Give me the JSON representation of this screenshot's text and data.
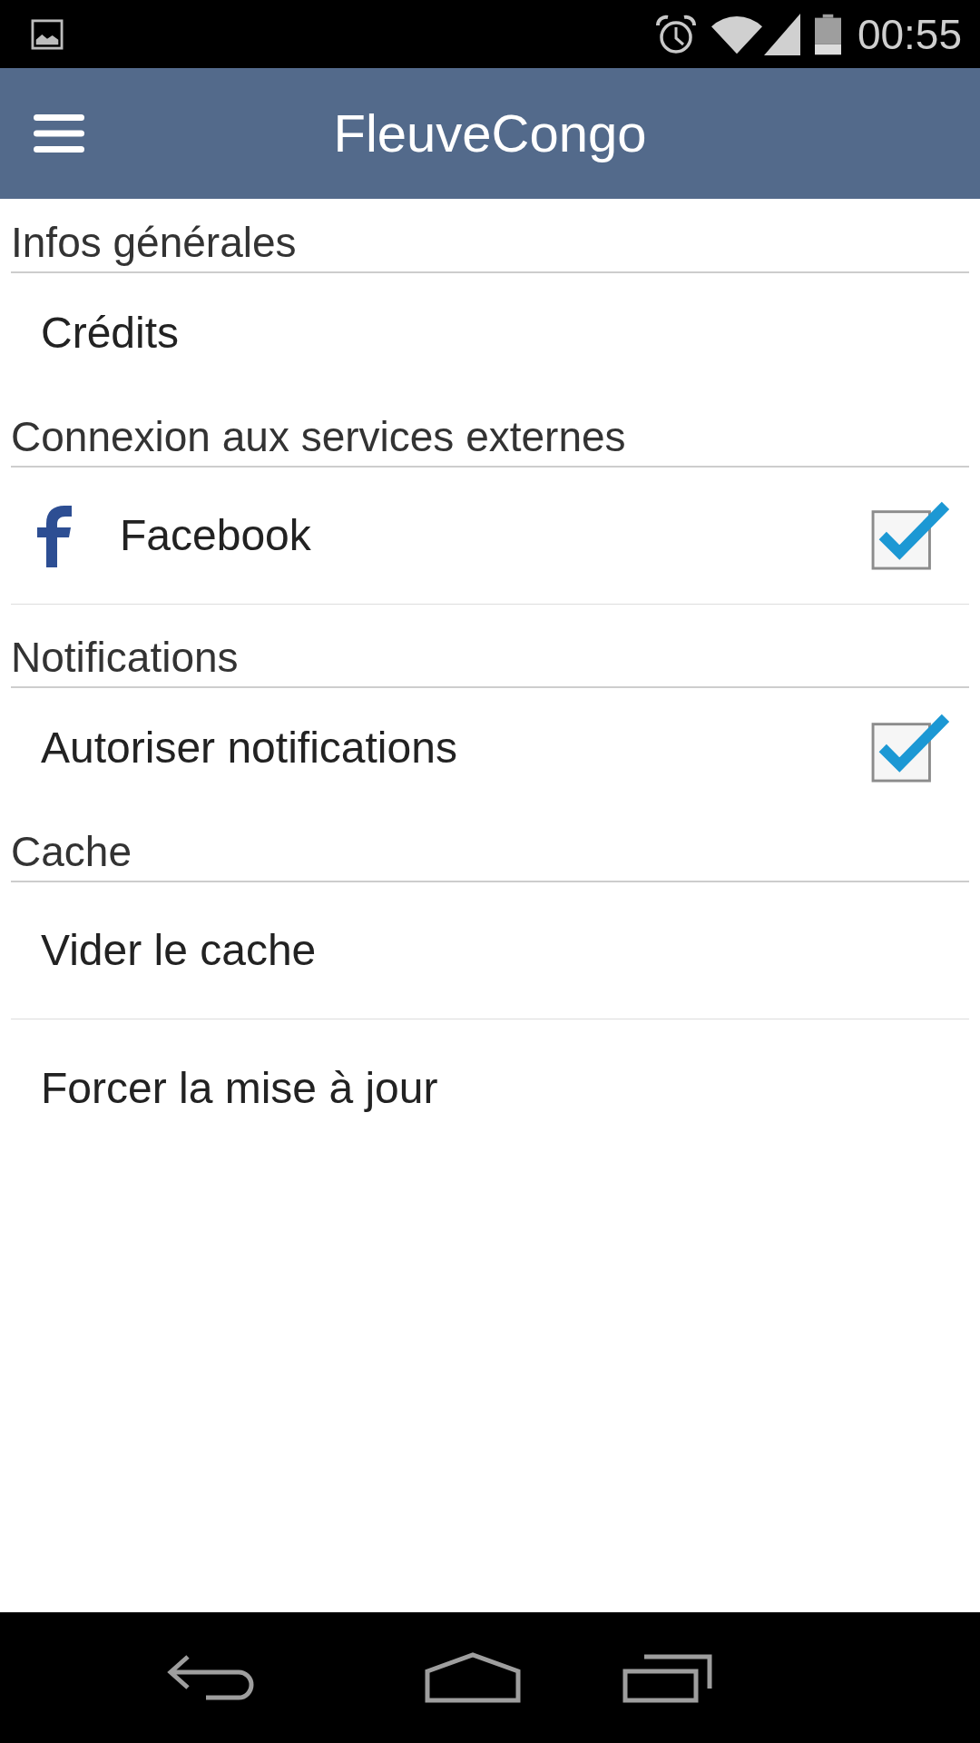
{
  "status_bar": {
    "time": "00:55"
  },
  "app_bar": {
    "title": "FleuveCongo"
  },
  "sections": [
    {
      "title": "Infos générales",
      "items": [
        {
          "kind": "link",
          "label": "Crédits",
          "divider": false
        }
      ]
    },
    {
      "title": "Connexion aux services externes",
      "items": [
        {
          "kind": "account",
          "label": "Facebook",
          "checked": true,
          "divider": true
        }
      ]
    },
    {
      "title": "Notifications",
      "items": [
        {
          "kind": "toggle",
          "label": "Autoriser notifications",
          "checked": true,
          "divider": false
        }
      ]
    },
    {
      "title": "Cache",
      "items": [
        {
          "kind": "link",
          "label": "Vider le cache",
          "divider": true
        },
        {
          "kind": "link",
          "label": "Forcer la mise à jour",
          "divider": false
        }
      ]
    }
  ]
}
